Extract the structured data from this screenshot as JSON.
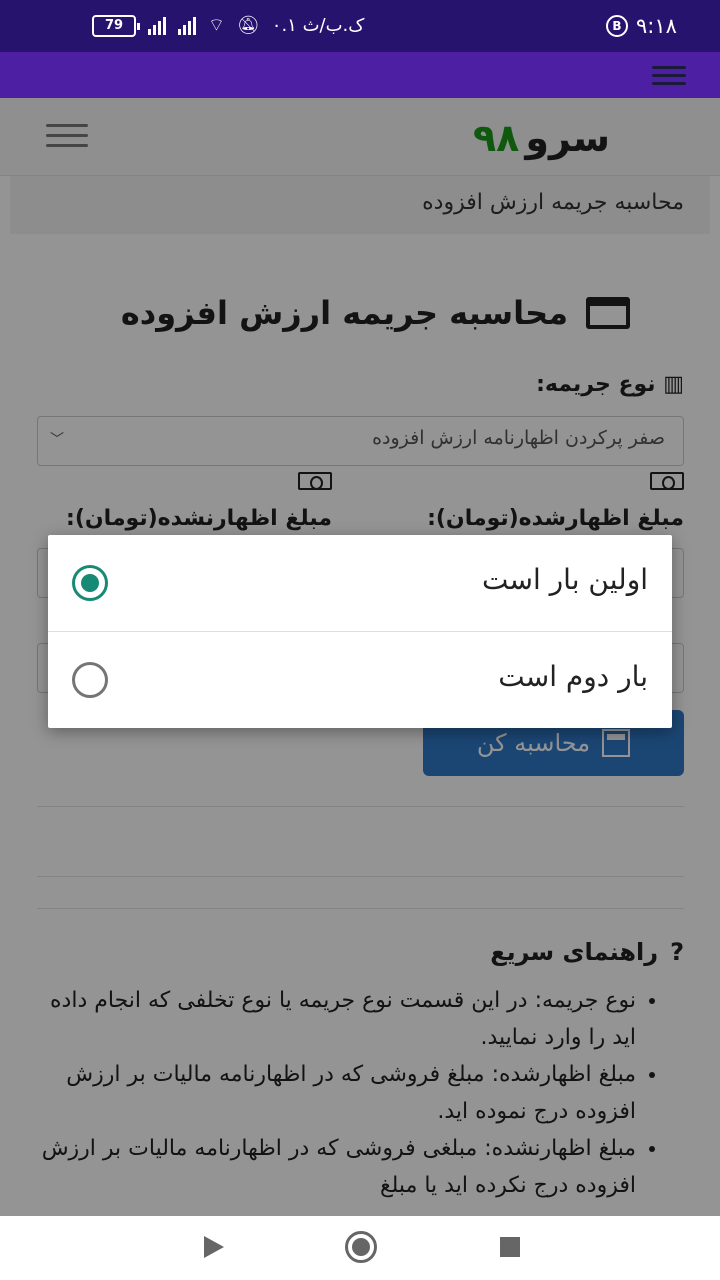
{
  "status_bar": {
    "time": "۹:۱۸",
    "b_label": "B",
    "carrier_speed": "۰.۱ ک.ب/ث",
    "battery": "79"
  },
  "site": {
    "logo_text": "سرو",
    "logo_number": "۹۸",
    "breadcrumb": "محاسبه جریمه ارزش افزوده",
    "page_title": "محاسبه جریمه ارزش افزوده"
  },
  "form": {
    "penalty_type_label": "نوع جریمه:",
    "penalty_type_value": "صفر پرکردن اظهارنامه ارزش افزوده",
    "declared_label": "مبلغ اظهارشده(تومان):",
    "undeclared_label": "مبلغ اظهارنشده(تومان):",
    "calculate_label": "محاسبه کن"
  },
  "dialog": {
    "options": [
      {
        "label": "اولین بار است",
        "selected": true
      },
      {
        "label": "بار دوم است",
        "selected": false
      }
    ],
    "accent_color": "#168a74"
  },
  "help": {
    "title": "راهنمای سریع",
    "items": [
      "نوع جریمه: در این قسمت نوع جریمه یا نوع تخلفی که انجام داده اید را وارد نمایید.",
      "مبلغ اظهارشده: مبلغ فروشی که در اظهارنامه مالیات بر ارزش افزوده درج نموده اید.",
      "مبلغ اظهارنشده: مبلغی فروشی که در اظهارنامه مالیات بر ارزش افزوده درج نکرده اید یا مبلغ"
    ]
  }
}
